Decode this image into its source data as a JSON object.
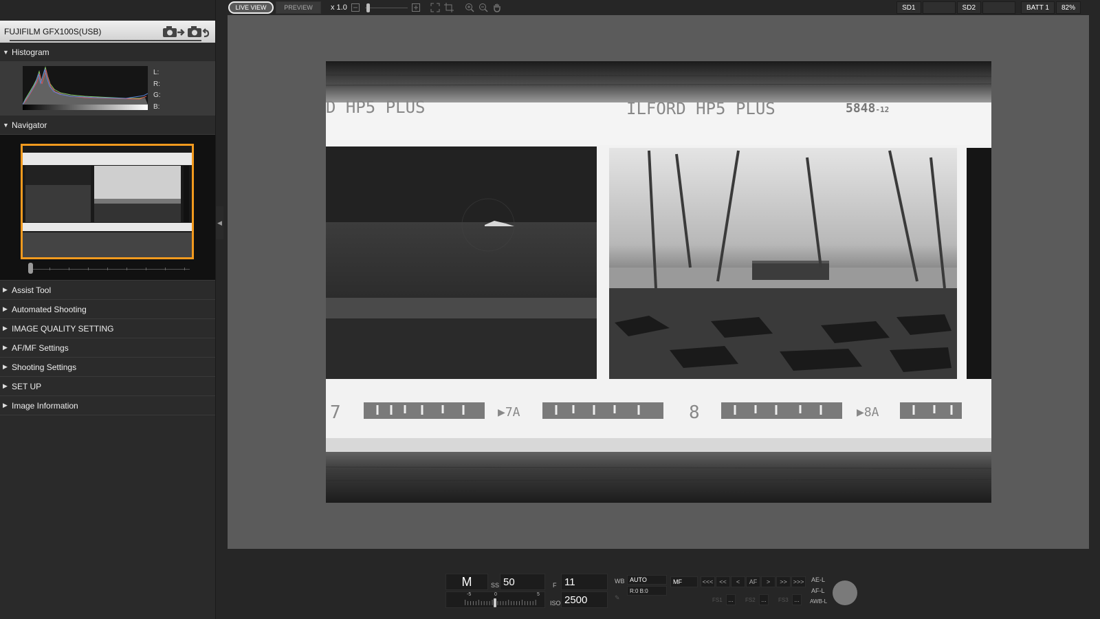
{
  "camera": {
    "name": "FUJIFILM GFX100S(USB)",
    "transfer_icon": "camera-export-icon",
    "import_icon": "camera-import-icon"
  },
  "sections": {
    "histogram": "Histogram",
    "navigator": "Navigator",
    "collapsed": [
      "Assist Tool",
      "Automated Shooting",
      "IMAGE QUALITY SETTING",
      "AF/MF Settings",
      "Shooting Settings",
      "SET UP",
      "Image Information"
    ]
  },
  "histogram_labels": {
    "l": "L:",
    "r": "R:",
    "g": "G:",
    "b": "B:"
  },
  "toolbar": {
    "live_view": "LIVE VIEW",
    "preview": "PREVIEW",
    "zoom": "x 1.0"
  },
  "status": {
    "sd1": "SD1",
    "sd2": "SD2",
    "batt": "BATT 1",
    "batt_pct": "82%"
  },
  "film": {
    "edge_text_left": "D HP5 PLUS",
    "edge_text_main": "ILFORD HP5 PLUS",
    "edge_code": "5848",
    "edge_code_suffix": "-12",
    "frame_num_7": "7",
    "frame_num_7a": "▶7A",
    "frame_num_8": "8",
    "frame_num_8a": "▶8A"
  },
  "controls": {
    "mode": "M",
    "ss_label": "SS",
    "ss_value": "50",
    "f_label": "F",
    "f_value": "11",
    "iso_label": "ISO",
    "iso_value": "2500",
    "wb_label": "WB",
    "wb_value": "AUTO",
    "wb_shift": "R:0 B:0",
    "focus_mode": "MF",
    "exp_minus": "-5",
    "exp_zero": "0",
    "exp_plus": "5",
    "nav_buttons": [
      "<<<",
      "<<",
      "<",
      "AF",
      ">",
      ">>",
      ">>>"
    ],
    "fs1": "FS1",
    "fs2": "FS2",
    "fs3": "FS3",
    "more": "...",
    "ael": "AE-L",
    "afl": "AF-L",
    "awbl": "AWB-L"
  },
  "colors": {
    "nav_frame": "#f39a1e",
    "accent_white": "#ffffff"
  }
}
